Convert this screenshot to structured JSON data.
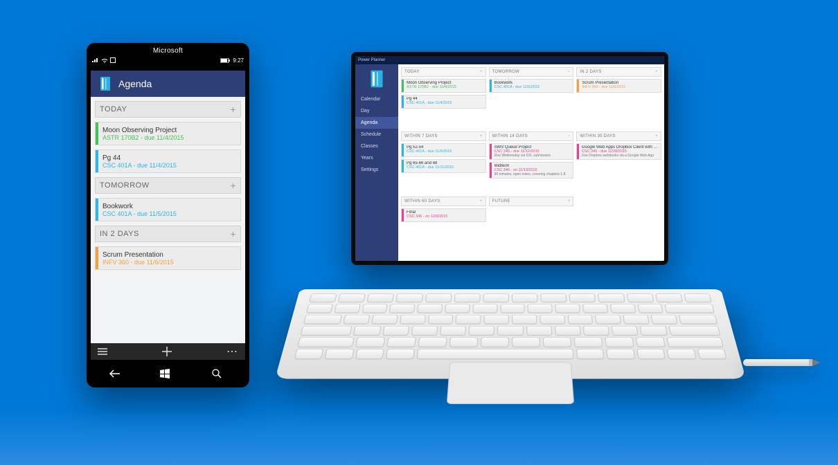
{
  "phone": {
    "brand": "Microsoft",
    "clock": "9:27",
    "header_title": "Agenda",
    "sections": [
      {
        "title": "TODAY",
        "items": [
          {
            "title": "Moon Observing Project",
            "sub": "ASTR 170B2 - due 11/4/2015",
            "color": "green"
          },
          {
            "title": "Pg 44",
            "sub": "CSC 401A - due 11/4/2015",
            "color": "cyan"
          }
        ]
      },
      {
        "title": "TOMORROW",
        "items": [
          {
            "title": "Bookwork",
            "sub": "CSC 401A - due 11/5/2015",
            "color": "cyan"
          }
        ]
      },
      {
        "title": "IN 2 DAYS",
        "items": [
          {
            "title": "Scrum Presentation",
            "sub": "INFV 360 - due 11/6/2015",
            "color": "orange"
          }
        ]
      }
    ]
  },
  "tablet": {
    "window_title": "Power Planner",
    "sidebar": [
      {
        "label": "Calendar",
        "active": false
      },
      {
        "label": "Day",
        "active": false
      },
      {
        "label": "Agenda",
        "active": true
      },
      {
        "label": "Schedule",
        "active": false
      },
      {
        "label": "Classes",
        "active": false
      },
      {
        "label": "Years",
        "active": false
      },
      {
        "label": "Settings",
        "active": false
      }
    ],
    "rows": [
      [
        {
          "title": "TODAY",
          "collapsible": "plus",
          "cards": [
            {
              "title": "Moon Observing Project",
              "sub": "ASTR 170B2 - due 11/4/2015",
              "color": "green"
            },
            {
              "title": "Pg 44",
              "sub": "CSC 401A - due 11/4/2015",
              "color": "cyan"
            }
          ]
        },
        {
          "title": "TOMORROW",
          "collapsible": "minus",
          "cards": [
            {
              "title": "Bookwork",
              "sub": "CSC 401A - due 11/5/2015",
              "color": "cyan"
            }
          ]
        },
        {
          "title": "IN 2 DAYS",
          "collapsible": "plus",
          "cards": [
            {
              "title": "Scrum Presentation",
              "sub": "INFV 360 - due 11/6/2015",
              "color": "orange"
            }
          ]
        }
      ],
      [
        {
          "title": "WITHIN 7 DAYS",
          "collapsible": "plus",
          "cards": [
            {
              "title": "Pg 52-54",
              "sub": "CSC 401A - due 11/9/2015",
              "color": "cyan"
            },
            {
              "title": "Pg 65-66 and 68",
              "sub": "CSC 401A - due 11/11/2015",
              "color": "cyan"
            }
          ]
        },
        {
          "title": "WITHIN 14 DAYS",
          "collapsible": "minus",
          "cards": [
            {
              "title": "AWS Queue Project",
              "sub": "CSC 346 - due 11/12/2015",
              "note": "Due Wednesday via D2L submission",
              "color": "pink"
            },
            {
              "title": "Midterm",
              "sub": "CSC 346 - on 11/13/2015",
              "note": "90 minutes, open notes, covering chapters 1-8",
              "color": "pink"
            }
          ]
        },
        {
          "title": "WITHIN 30 DAYS",
          "collapsible": "plus",
          "cards": [
            {
              "title": "Google Web Apps Dropbox Client with a long title",
              "sub": "CSC 346 - due 11/28/2015",
              "note": "Use Dropbox webhooks via a Google Web App",
              "color": "pink"
            }
          ]
        }
      ],
      [
        {
          "title": "WITHIN 60 DAYS",
          "collapsible": "plus",
          "cards": [
            {
              "title": "Final",
              "sub": "CSC 346 - on 12/9/2015",
              "color": "pink"
            }
          ]
        },
        {
          "title": "FUTURE",
          "collapsible": "plus",
          "cards": []
        },
        null
      ]
    ]
  }
}
